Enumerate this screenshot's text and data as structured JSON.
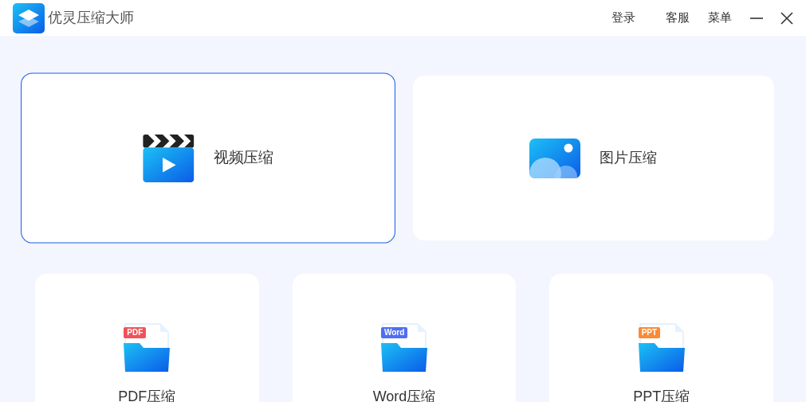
{
  "header": {
    "title": "优灵压缩大师",
    "actions": [
      {
        "label": "登录"
      },
      {
        "label": "客服"
      },
      {
        "label": "菜单"
      }
    ]
  },
  "media_cards": [
    {
      "label": "视频压缩",
      "kind": "video",
      "selected": true
    },
    {
      "label": "图片压缩",
      "kind": "image",
      "selected": false
    }
  ],
  "document_cards": [
    {
      "label": "PDF压缩",
      "tag": "PDF",
      "color": "#f0525a",
      "selected": false
    },
    {
      "label": "Word压缩",
      "tag": "Word",
      "color": "#4f6ef2",
      "selected": false
    },
    {
      "label": "PPT压缩",
      "tag": "PPT",
      "color": "#fb8a35",
      "selected": false
    }
  ]
}
